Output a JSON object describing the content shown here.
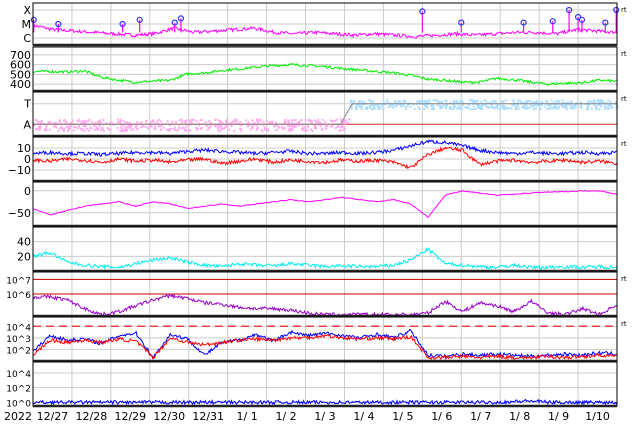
{
  "chart_data": {
    "type": "line",
    "title": "",
    "x_start_label": "2022",
    "x_tick_labels": [
      "12/27",
      "12/28",
      "12/29",
      "12/30",
      "12/31",
      "1/ 1",
      "1/ 2",
      "1/ 3",
      "1/ 4",
      "1/ 5",
      "1/ 6",
      "1/ 7",
      "1/ 8",
      "1/ 9",
      "1/10"
    ],
    "x_unit": "days, sampled every 12 h",
    "right_marker": "rt",
    "panels": [
      {
        "id": "xray",
        "ylim": [
          -0.5,
          2.5
        ],
        "ticks": [
          {
            "v": 2,
            "label": "X"
          },
          {
            "v": 1,
            "label": "M"
          },
          {
            "v": 0,
            "label": "C"
          }
        ],
        "rt": true,
        "series": [
          {
            "name": "xray-flux",
            "color": "#ff00ff",
            "values": [
              0.9,
              0.6,
              0.5,
              0.4,
              0.3,
              0.2,
              0.3,
              0.7,
              0.4,
              0.5,
              0.6,
              0.7,
              0.4,
              0.3,
              0.4,
              0.3,
              0.2,
              0.3,
              0.2,
              0.1,
              0.2,
              0.3,
              0.2,
              0.3,
              0.4,
              0.4,
              0.3,
              0.6,
              0.5,
              0.4
            ]
          }
        ],
        "flares": [
          {
            "t": 0.02,
            "v": 1.3
          },
          {
            "t": 0.65,
            "v": 1.0
          },
          {
            "t": 2.3,
            "v": 1.0
          },
          {
            "t": 2.74,
            "v": 1.3
          },
          {
            "t": 3.64,
            "v": 1.1
          },
          {
            "t": 3.8,
            "v": 1.4
          },
          {
            "t": 10.0,
            "v": 1.9
          },
          {
            "t": 11.0,
            "v": 1.1
          },
          {
            "t": 12.6,
            "v": 1.1
          },
          {
            "t": 13.35,
            "v": 1.2
          },
          {
            "t": 13.77,
            "v": 2.0
          },
          {
            "t": 14.0,
            "v": 1.5
          },
          {
            "t": 14.1,
            "v": 1.3
          },
          {
            "t": 14.7,
            "v": 1.1
          },
          {
            "t": 14.98,
            "v": 2.0
          }
        ]
      },
      {
        "id": "wind-speed",
        "ylim": [
          330,
          780
        ],
        "ticks": [
          {
            "v": 700,
            "label": "700"
          },
          {
            "v": 600,
            "label": "600"
          },
          {
            "v": 500,
            "label": "500"
          },
          {
            "v": 400,
            "label": "400"
          }
        ],
        "rt": true,
        "series": [
          {
            "name": "solar-wind-speed",
            "color": "#00ee00",
            "values": [
              530,
              530,
              525,
              535,
              470,
              440,
              420,
              430,
              440,
              505,
              515,
              540,
              555,
              575,
              590,
              600,
              590,
              580,
              560,
              545,
              530,
              515,
              490,
              450,
              440,
              420,
              420,
              460,
              445,
              420,
              400,
              410,
              415,
              440,
              430
            ]
          }
        ]
      },
      {
        "id": "imf-sector",
        "ylim": [
          0,
          3
        ],
        "ticks": [
          {
            "v": 2.2,
            "label": "T"
          },
          {
            "v": 0.8,
            "label": "A"
          }
        ],
        "rt": true,
        "series": [
          {
            "name": "sector-away",
            "color": "#ffaaee",
            "values": [
              0.8,
              0.8,
              0.8,
              0.8,
              0.8,
              0.8,
              0.8,
              0.8,
              0.8,
              0.8,
              0.8,
              0.8,
              0.8,
              0.8,
              0.8,
              0.8,
              0.8,
              0.8,
              0.8,
              0.8,
              0.8
            ]
          },
          {
            "name": "sector-toward",
            "color": "#aaddff",
            "values": [
              2.2,
              2.2,
              2.2,
              2.2,
              2.2,
              2.2,
              2.2,
              2.2,
              2.2,
              2.2,
              2.2,
              2.2,
              2.2,
              2.2
            ]
          }
        ]
      },
      {
        "id": "imf-bz",
        "ylim": [
          -20,
          20
        ],
        "ticks": [
          {
            "v": 10,
            "label": "10"
          },
          {
            "v": 0,
            "label": "0"
          },
          {
            "v": -10,
            "label": "−10"
          }
        ],
        "rt": true,
        "series": [
          {
            "name": "bt",
            "color": "#0000ff",
            "values": [
              5,
              6,
              5,
              5,
              4,
              5,
              6,
              6,
              5,
              7,
              8,
              7,
              6,
              5,
              6,
              7,
              5,
              5,
              6,
              5,
              6,
              8,
              12,
              16,
              15,
              12,
              8,
              6,
              5,
              6,
              5,
              5,
              6,
              5,
              6
            ]
          },
          {
            "name": "bz",
            "color": "#ff0000",
            "values": [
              -1,
              -2,
              0,
              -1,
              -3,
              0,
              -2,
              -1,
              -3,
              -1,
              0,
              -4,
              -2,
              0,
              -3,
              -1,
              -2,
              -3,
              -1,
              -2,
              -1,
              -3,
              -8,
              4,
              10,
              8,
              -5,
              -2,
              -1,
              -3,
              -2,
              -1,
              -3,
              -2,
              -4
            ]
          }
        ]
      },
      {
        "id": "dst",
        "ylim": [
          -80,
          20
        ],
        "ticks": [
          {
            "v": 0,
            "label": "0"
          },
          {
            "v": -50,
            "label": "−50"
          }
        ],
        "rt": false,
        "series": [
          {
            "name": "dst-index",
            "color": "#ff00ff",
            "values": [
              -40,
              -55,
              -45,
              -35,
              -30,
              -25,
              -35,
              -25,
              -30,
              -40,
              -35,
              -30,
              -35,
              -30,
              -25,
              -20,
              -25,
              -20,
              -15,
              -20,
              -25,
              -20,
              -30,
              -60,
              -10,
              0,
              -5,
              -10,
              -8,
              -5,
              -3,
              -2,
              0,
              0,
              -8
            ]
          }
        ]
      },
      {
        "id": "kp",
        "ylim": [
          0,
          60
        ],
        "ticks": [
          {
            "v": 40,
            "label": "40"
          },
          {
            "v": 20,
            "label": "20"
          }
        ],
        "rt": false,
        "series": [
          {
            "name": "density",
            "color": "#00eeee",
            "values": [
              20,
              25,
              12,
              8,
              6,
              5,
              10,
              15,
              18,
              12,
              8,
              6,
              10,
              8,
              7,
              10,
              8,
              6,
              7,
              6,
              6,
              8,
              15,
              30,
              10,
              8,
              6,
              5,
              8,
              5,
              5,
              6,
              5,
              6,
              5
            ]
          }
        ]
      },
      {
        "id": "electron-flux",
        "ylim": [
          4.5,
          7.5
        ],
        "log": true,
        "ticks": [
          {
            "v": 7,
            "label": "10^7"
          },
          {
            "v": 6,
            "label": "10^6"
          }
        ],
        "thresholds": [
          7,
          6
        ],
        "rt": true,
        "series": [
          {
            "name": "electron-flux-2mev",
            "color": "#9900cc",
            "values": [
              5.8,
              5.8,
              5.6,
              5.0,
              4.6,
              4.8,
              5.2,
              5.6,
              5.9,
              5.7,
              5.4,
              5.3,
              5.1,
              5.0,
              5.0,
              4.9,
              4.7,
              4.6,
              4.6,
              4.6,
              4.6,
              4.6,
              4.6,
              4.7,
              5.5,
              4.8,
              5.4,
              5.2,
              4.8,
              5.5,
              4.7,
              4.6,
              5.0,
              4.6,
              5.3
            ]
          }
        ]
      },
      {
        "id": "proton-flux",
        "ylim": [
          1,
          4.8
        ],
        "log": true,
        "ticks": [
          {
            "v": 4,
            "label": "10^4"
          },
          {
            "v": 3,
            "label": "10^3"
          },
          {
            "v": 2,
            "label": "10^2"
          }
        ],
        "dashed": 4,
        "rt": true,
        "series": [
          {
            "name": "proton-flux-blue",
            "color": "#0000ff",
            "values": [
              1.8,
              3.2,
              2.8,
              2.9,
              2.5,
              3.2,
              3.4,
              1.3,
              3.3,
              2.9,
              1.5,
              2.6,
              2.8,
              3.3,
              2.7,
              3.5,
              3.2,
              3.4,
              3.2,
              3.0,
              3.3,
              3.0,
              3.6,
              1.5,
              1.4,
              1.6,
              1.5,
              1.6,
              1.5,
              1.4,
              1.5,
              1.6,
              1.5,
              1.7,
              1.6
            ]
          },
          {
            "name": "proton-flux-red",
            "color": "#ff0000",
            "values": [
              1.5,
              2.8,
              2.6,
              2.8,
              2.6,
              2.9,
              2.7,
              1.3,
              3.0,
              2.6,
              2.4,
              2.6,
              2.8,
              2.9,
              2.8,
              3.0,
              3.0,
              3.2,
              3.0,
              2.9,
              3.0,
              2.9,
              3.1,
              1.3,
              1.3,
              1.4,
              1.3,
              1.4,
              1.3,
              1.3,
              1.4,
              1.3,
              1.4,
              1.5,
              1.4
            ]
          }
        ]
      },
      {
        "id": "high-energy-proton",
        "ylim": [
          -0.5,
          5.5
        ],
        "log": true,
        "ticks": [
          {
            "v": 4,
            "label": "10^4"
          },
          {
            "v": 2,
            "label": "10^2"
          },
          {
            "v": 0,
            "label": "10^0"
          }
        ],
        "rt": false,
        "series": [
          {
            "name": "proton-flux-high",
            "color": "#0000ff",
            "values": [
              0,
              0,
              0,
              0,
              0,
              0,
              0,
              0,
              0,
              0,
              0,
              0,
              0,
              0,
              0,
              0,
              0,
              0,
              0,
              0,
              0,
              0,
              0,
              0,
              0,
              0,
              0,
              0,
              0.1,
              0.2,
              0,
              0,
              0,
              0,
              0
            ]
          }
        ]
      }
    ]
  }
}
